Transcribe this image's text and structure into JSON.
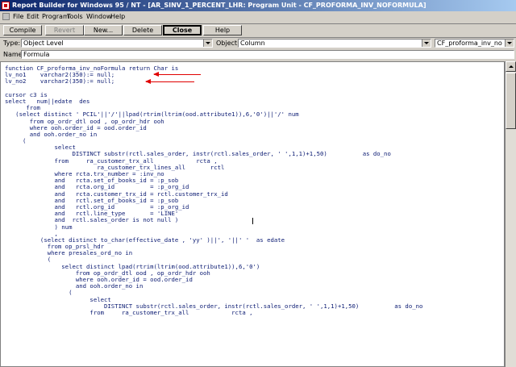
{
  "window": {
    "title": "Report Builder for Windows 95 / NT - [AR_SINV_1_PERCENT_LHR: Program Unit - CF_PROFORMA_INV_NOFORMULA]"
  },
  "menu": {
    "items": [
      "File",
      "Edit",
      "Program",
      "Tools",
      "Window",
      "Help"
    ]
  },
  "toolbar": {
    "compile": "Compile",
    "revert": "Revert",
    "new": "New...",
    "delete": "Delete",
    "close": "Close",
    "help": "Help"
  },
  "context": {
    "type_label": "Type:",
    "type_value": "Object Level",
    "object_label": "Object:",
    "object_value": "Column",
    "unit_value": "CF_proforma_inv_no",
    "name_label": "Name:",
    "name_value": "Formula"
  },
  "code": {
    "lines": [
      "function CF_proforma_inv_noFormula return Char is",
      "lv_no1    varchar2(350):= null;",
      "lv_no2    varchar2(350):= null;",
      "",
      "cursor c3 is",
      "select   num||edate  des",
      "      from",
      "   (select distinct ' PCIL'||'/'||lpad(rtrim(ltrim(ood.attribute1)),6,'0')||'/' num",
      "       from op_ordr_dtl ood , op_ordr_hdr ooh",
      "       where ooh.order_id = ood.order_id",
      "       and ooh.order_no in",
      "     (",
      "              select",
      "                   DISTINCT substr(rctl.sales_order, instr(rctl.sales_order, ' ',1,1)+1,50)          as do_no",
      "              from     ra_customer_trx_all            rcta ,",
      "                          ra_customer_trx_lines_all       rctl",
      "              where rcta.trx_number = :inv_no",
      "              and   rcta.set_of_books_id = :p_sob",
      "              and   rcta.org_id          = :p_org_id",
      "              and   rcta.customer_trx_id = rctl.customer_trx_id",
      "              and   rctl.set_of_books_id = :p_sob",
      "              and   rctl.org_id          = :p_org_id",
      "              and   rctl.line_type       = 'LINE'",
      "              and  rctl.sales_order is not null )",
      "              ) num",
      "              ,",
      "          (select distinct to_char(effective_date , 'yy' )||', '||' '  as edate",
      "            from op_prsl_hdr",
      "            where presales_ord_no in",
      "            (",
      "                select distinct lpad(rtrim(ltrim(ood.attribute1)),6,'0')",
      "                    from op_ordr_dtl ood , op_ordr_hdr ooh",
      "                    where ooh.order_id = ood.order_id",
      "                    and ooh.order_no in",
      "                  (",
      "                        select",
      "                            DISTINCT substr(rctl.sales_order, instr(rctl.sales_order, ' ',1,1)+1,50)          as do_no",
      "                        from     ra_customer_trx_all            rcta ,"
    ]
  },
  "colors": {
    "titlebar_start": "#0a246a",
    "titlebar_end": "#a6caf0",
    "code_text": "#0a1a72",
    "annotation_arrow": "#e00000"
  }
}
